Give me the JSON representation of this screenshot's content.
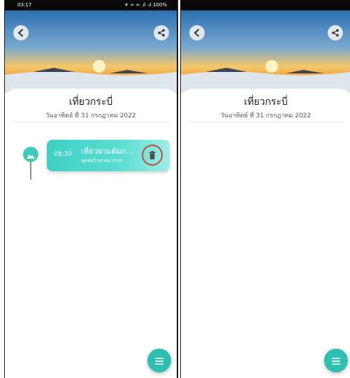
{
  "status_bar": {
    "time": "03:17",
    "indicators": "✶ ≈ ≈ .ıl .ıl 100%"
  },
  "icons": {
    "back": "back-arrow-icon",
    "share": "share-icon",
    "trash": "trash-icon",
    "menu": "menu-lines-icon",
    "mountain": "mountain-icon"
  },
  "trip": {
    "title": "เที่ยวกระบี่",
    "date": "วันอาทิตย์ ที่ 31 กรกฎาคม 2022"
  },
  "entries": [
    {
      "time": "08:30",
      "name": "เที่ยวผาแต้มก...",
      "desc": "จุดชมวิวสวยมากกก"
    }
  ],
  "colors": {
    "accent": "#3ecbbd",
    "card_start": "#3fd0c3",
    "fab": "#2fbfb0",
    "highlight_ring": "#c24a3a"
  }
}
